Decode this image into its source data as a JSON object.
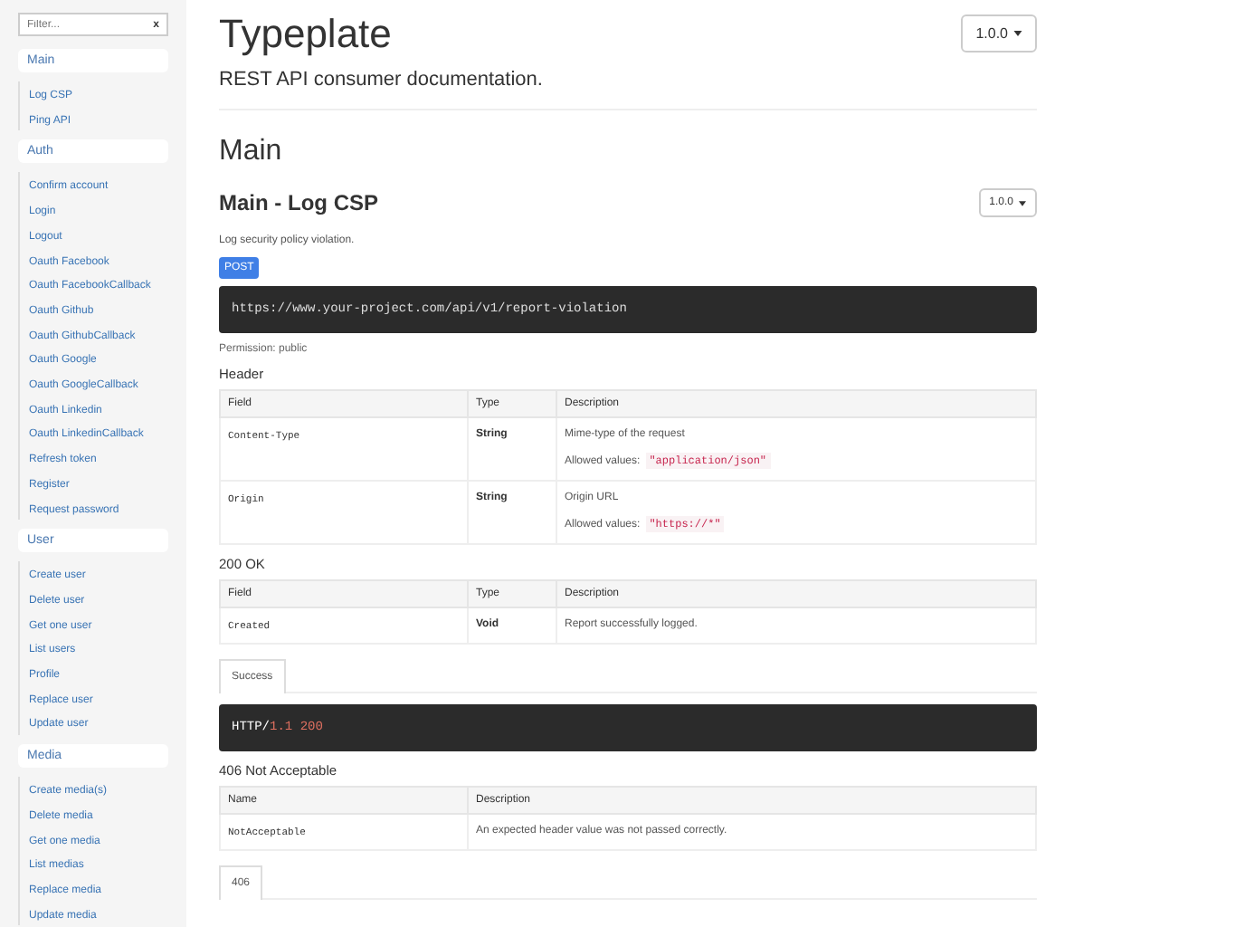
{
  "sidebar": {
    "filter": {
      "placeholder": "Filter...",
      "clear": "x"
    },
    "groups": [
      {
        "title": "Main",
        "items": [
          "Log CSP",
          "Ping API"
        ]
      },
      {
        "title": "Auth",
        "items": [
          "Confirm account",
          "Login",
          "Logout",
          "Oauth Facebook",
          "Oauth FacebookCallback",
          "Oauth Github",
          "Oauth GithubCallback",
          "Oauth Google",
          "Oauth GoogleCallback",
          "Oauth Linkedin",
          "Oauth LinkedinCallback",
          "Refresh token",
          "Register",
          "Request password"
        ]
      },
      {
        "title": "User",
        "items": [
          "Create user",
          "Delete user",
          "Get one user",
          "List users",
          "Profile",
          "Replace user",
          "Update user"
        ]
      },
      {
        "title": "Media",
        "items": [
          "Create media(s)",
          "Delete media",
          "Get one media",
          "List medias",
          "Replace media",
          "Update media"
        ]
      }
    ]
  },
  "header": {
    "title": "Typeplate",
    "version": "1.0.0",
    "subtitle": "REST API consumer documentation."
  },
  "section": {
    "title": "Main",
    "endpoint": {
      "title": "Main - Log CSP",
      "version": "1.0.0",
      "description": "Log security policy violation.",
      "method": "POST",
      "url": "https://www.your-project.com/api/v1/report-violation",
      "permission": "Permission: public",
      "blocks": [
        {
          "kind": "params",
          "title": "Header",
          "columns": [
            "Field",
            "Type",
            "Description"
          ],
          "rows": [
            {
              "field": "Content-Type",
              "type": "String",
              "description": "Mime-type of the request",
              "allowed_label": "Allowed values:",
              "allowed_value": "\"application/json\""
            },
            {
              "field": "Origin",
              "type": "String",
              "description": "Origin URL",
              "allowed_label": "Allowed values:",
              "allowed_value": "\"https://*\""
            }
          ]
        },
        {
          "kind": "params",
          "title": "200 OK",
          "columns": [
            "Field",
            "Type",
            "Description"
          ],
          "rows": [
            {
              "field": "Created",
              "type": "Void",
              "description": "Report successfully logged."
            }
          ]
        },
        {
          "kind": "example",
          "tabs": [
            {
              "label": "Success",
              "selected": true
            }
          ],
          "code": [
            {
              "text": "HTTP/",
              "kind": "plain"
            },
            {
              "text": "1.1 200",
              "kind": "literal"
            }
          ]
        },
        {
          "kind": "errors",
          "title": "406 Not Acceptable",
          "columns": [
            "Name",
            "Description"
          ],
          "rows": [
            {
              "field": "NotAcceptable",
              "description": "An expected header value was not passed correctly."
            }
          ]
        },
        {
          "kind": "example",
          "tabs": [
            {
              "label": "406",
              "selected": true
            }
          ]
        }
      ]
    }
  }
}
